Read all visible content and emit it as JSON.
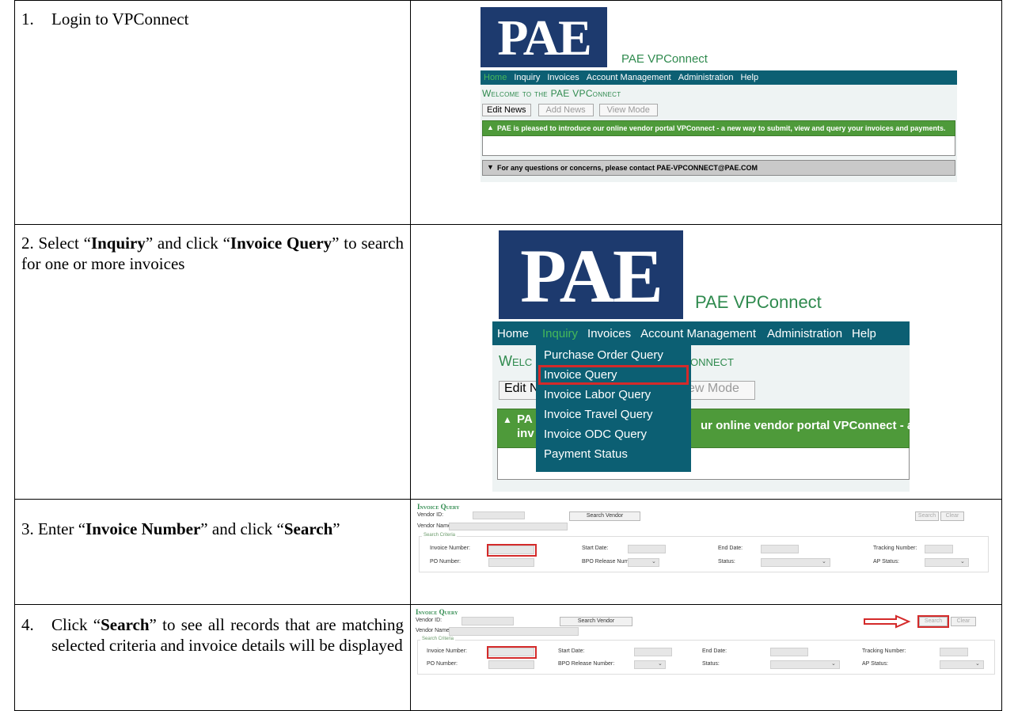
{
  "steps": [
    {
      "number": "1.",
      "text": "Login to VPConnect"
    },
    {
      "parts": [
        "2. Select “",
        "Inquiry",
        "” and click “",
        "Invoice Query",
        "” to search for one or more invoices"
      ]
    },
    {
      "parts": [
        "3. Enter “",
        "Invoice Number",
        "” and click “",
        "Search",
        "”"
      ]
    },
    {
      "number": "4.",
      "parts": [
        "Click “",
        "Search",
        "” to see all records that are matching selected criteria and invoice details will be displayed"
      ]
    }
  ],
  "portal": {
    "logo": "PAE",
    "name": "PAE VPConnect",
    "nav": [
      "Home",
      "Inquiry",
      "Invoices",
      "Account Management",
      "Administration",
      "Help"
    ],
    "welcome": "Welcome to the PAE VPConnect",
    "welcome_cropped": "Welc",
    "welcome_tail": "onnect",
    "buttons": {
      "edit": "Edit News",
      "add": "Add News",
      "view": "View Mode",
      "edit_cropped": "Edit N",
      "view_cropped": "ew Mode"
    },
    "news": "PAE is pleased to introduce our online vendor portal VPConnect - a new way to submit, view and query your invoices and payments.",
    "news_cropped_a": "PA",
    "news_cropped_b": "inv",
    "news_tail": "ur online vendor portal VPConnect - a",
    "contact": "For any questions or concerns, please contact PAE-VPCONNECT@PAE.COM"
  },
  "inquiry_menu": [
    "Purchase Order Query",
    "Invoice Query",
    "Invoice Labor Query",
    "Invoice Travel Query",
    "Invoice ODC Query",
    "Payment Status"
  ],
  "query_form": {
    "title": "Invoice Query",
    "vendor_id": "Vendor ID:",
    "vendor_name": "Vendor Name:",
    "search_vendor": "Search Vendor",
    "search": "Search",
    "clear": "Clear",
    "criteria": "Search Criteria",
    "invoice_number": "Invoice Number:",
    "start_date": "Start Date:",
    "end_date": "End Date:",
    "tracking_number": "Tracking Number:",
    "po_number": "PO Number:",
    "bpo_release": "BPO Release Number:",
    "status": "Status:",
    "ap_status": "AP Status:"
  },
  "colors": {
    "logo_bg": "#1d3a6e",
    "nav_bg": "#0c5f73",
    "green": "#2f8a4e",
    "news_bg": "#4e9a3a",
    "highlight": "#d42a2a"
  }
}
